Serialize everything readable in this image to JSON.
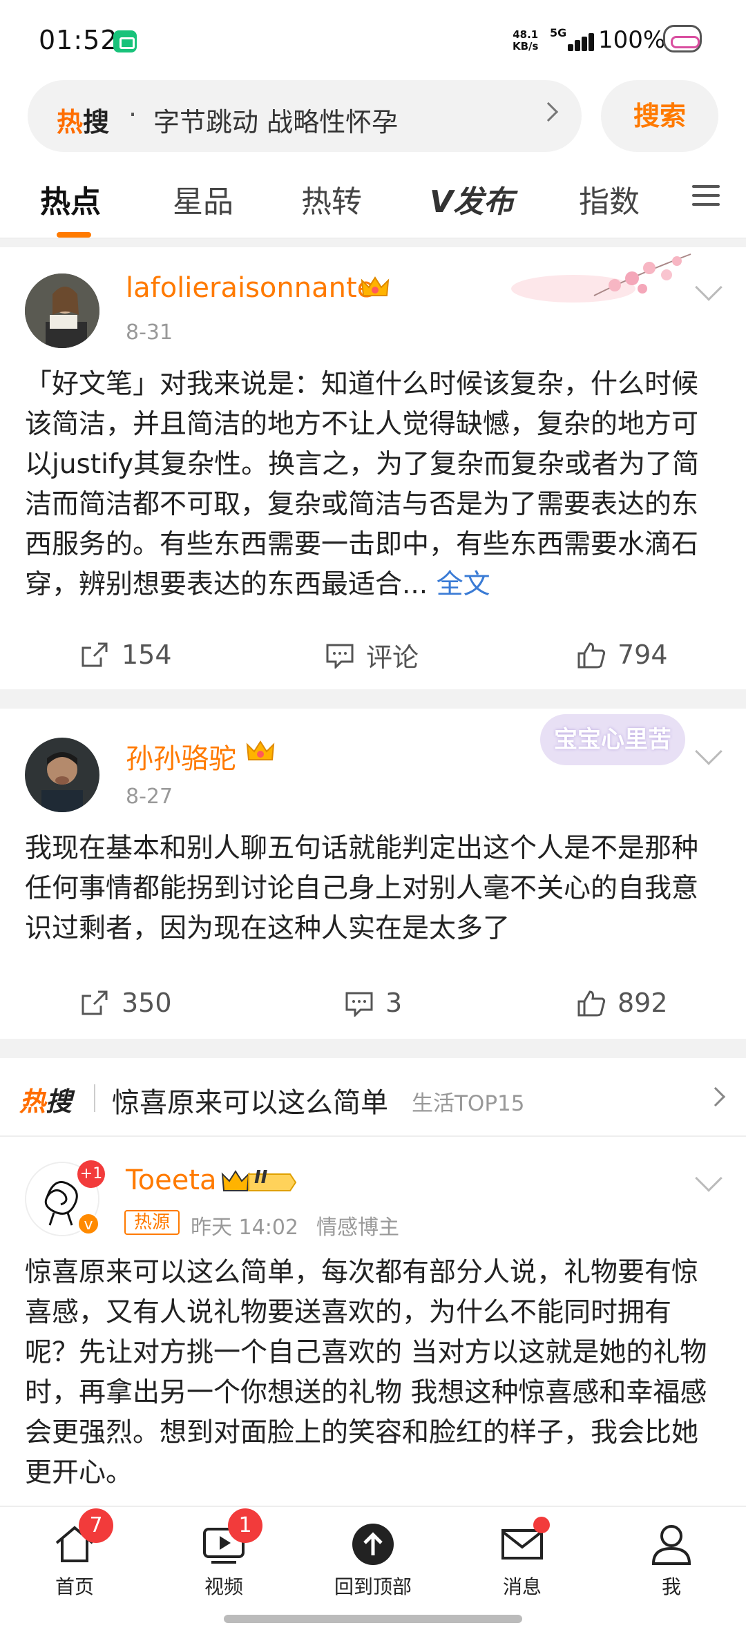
{
  "status_bar": {
    "time": "01:52",
    "speed_value": "48.1",
    "speed_unit": "KB/s",
    "network": "5G",
    "battery": "100%"
  },
  "search": {
    "brand": "热搜",
    "brand_accent": "热",
    "brand_rest": "搜",
    "separator": "·",
    "query": "字节跳动 战略性怀孕",
    "button": "搜索"
  },
  "tabs": [
    "热点",
    "星品",
    "热转",
    "发布",
    "指数"
  ],
  "posts": [
    {
      "username": "lafolieraisonnante",
      "date": "8-31",
      "body": "「好文笔」对我来说是：知道什么时候该复杂，什么时候该简洁，并且简洁的地方不让人觉得缺憾，复杂的地方可以justify其复杂性。换言之，为了复杂而复杂或者为了简洁而简洁都不可取，复杂或简洁与否是为了需要表达的东西服务的。有些东西需要一击即中，有些东西需要水滴石穿，辨别想要表达的东西最适合...",
      "more": "全文",
      "reposts": "154",
      "comments": "评论",
      "likes": "794"
    },
    {
      "username": "孙孙骆驼",
      "date": "8-27",
      "body": "我现在基本和别人聊五句话就能判定出这个人是不是那种任何事情都能拐到讨论自己身上对别人毫不关心的自我意识过剩者，因为现在这种人实在是太多了",
      "reposts": "350",
      "comments": "3",
      "likes": "892",
      "sticker": "宝宝心里苦"
    }
  ],
  "hot_topic": {
    "logo_accent": "热",
    "logo_rest": "搜",
    "title": "惊喜原来可以这么简单",
    "tag": "生活TOP15"
  },
  "post3": {
    "username": "Toeeta",
    "level": "II",
    "avatar_badge": "+1",
    "source_badge": "热源",
    "time": "昨天 14:02",
    "role": "情感博主",
    "body": "惊喜原来可以这么简单，每次都有部分人说，礼物要有惊喜感，又有人说礼物要送喜欢的，为什么不能同时拥有呢？先让对方挑一个自己喜欢的 当对方以这就是她的礼物时，再拿出另一个你想送的礼物 我想这种惊喜感和幸福感会更强烈。想到对面脸上的笑容和脸红的样子，我会比她更开心。"
  },
  "bottom_nav": [
    {
      "label": "首页",
      "badge": "7"
    },
    {
      "label": "视频",
      "badge": "1"
    },
    {
      "label": "回到顶部"
    },
    {
      "label": "消息"
    },
    {
      "label": "我"
    }
  ],
  "colors": {
    "accent": "#ff7a00",
    "link": "#3a7bd5",
    "badge_red": "#f23b3b"
  }
}
